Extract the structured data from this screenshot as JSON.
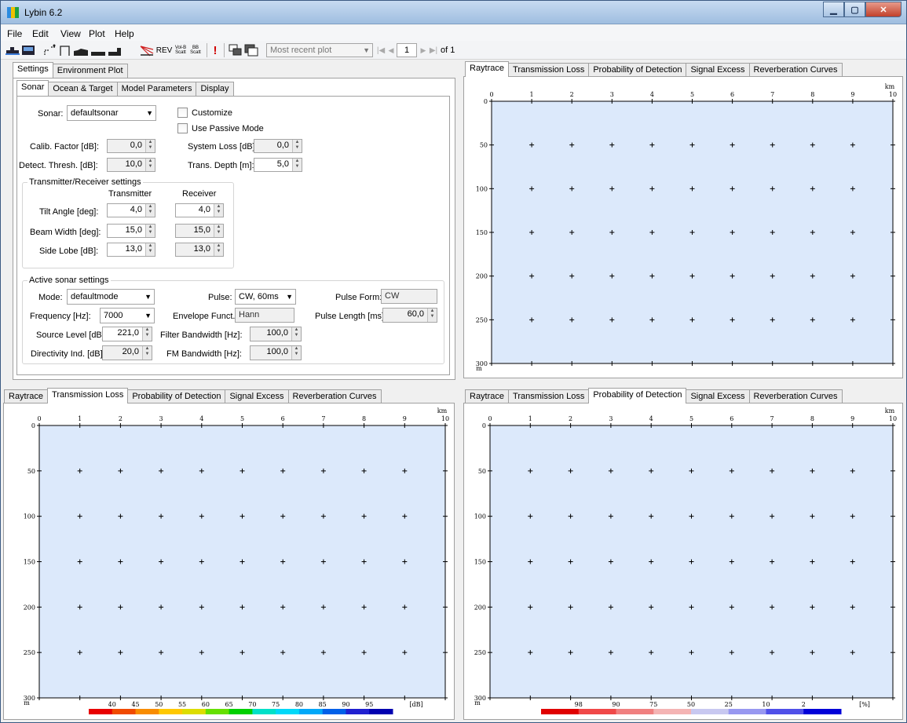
{
  "window": {
    "title": "Lybin 6.2",
    "accent": "#9fbee0"
  },
  "menu": [
    "File",
    "Edit",
    "View",
    "Plot",
    "Help"
  ],
  "toolbar": {
    "rev_label": "REV",
    "volb_label": "Vol-B",
    "scatt_label": "Scatt",
    "bb_label": "BB",
    "scatt2_label": "Scatt",
    "plot_select": "Most recent plot",
    "page": "1",
    "of_label": "of 1"
  },
  "settings_tabs": [
    "Settings",
    "Environment Plot"
  ],
  "sub_tabs": [
    "Sonar",
    "Ocean & Target",
    "Model Parameters",
    "Display"
  ],
  "sonar": {
    "sonar_label": "Sonar:",
    "sonar_value": "defaultsonar",
    "customize": "Customize",
    "passive": "Use Passive Mode",
    "calib_label": "Calib. Factor [dB]:",
    "calib_value": "0,0",
    "sysloss_label": "System Loss [dB]:",
    "sysloss_value": "0,0",
    "detect_label": "Detect. Thresh. [dB]:",
    "detect_value": "10,0",
    "depth_label": "Trans. Depth [m]:",
    "depth_value": "5,0"
  },
  "trx": {
    "title": "Transmitter/Receiver settings",
    "col_tx": "Transmitter",
    "col_rx": "Receiver",
    "rows": [
      {
        "label": "Tilt Angle [deg]:",
        "tx": "4,0",
        "rx": "4,0"
      },
      {
        "label": "Beam Width [deg]:",
        "tx": "15,0",
        "rx": "15,0"
      },
      {
        "label": "Side Lobe [dB]:",
        "tx": "13,0",
        "rx": "13,0"
      }
    ]
  },
  "active": {
    "title": "Active sonar settings",
    "mode_label": "Mode:",
    "mode_value": "defaultmode",
    "pulse_label": "Pulse:",
    "pulse_value": "CW, 60ms",
    "pulseform_label": "Pulse Form:",
    "pulseform_value": "CW",
    "freq_label": "Frequency [Hz]:",
    "freq_value": "7000",
    "env_label": "Envelope Funct.:",
    "env_value": "Hann",
    "plen_label": "Pulse Length [ms]:",
    "plen_value": "60,0",
    "sl_label": "Source Level [dB]:",
    "sl_value": "221,0",
    "fbw_label": "Filter Bandwidth [Hz]:",
    "fbw_value": "100,0",
    "di_label": "Directivity Ind. [dB]:",
    "di_value": "20,0",
    "fmbw_label": "FM Bandwidth [Hz]:",
    "fmbw_value": "100,0"
  },
  "plot_tabs": [
    "Raytrace",
    "Transmission Loss",
    "Probability of Detection",
    "Signal Excess",
    "Reverberation Curves"
  ],
  "chart_data": [
    {
      "type": "heatmap",
      "panel": "Raytrace",
      "x_ticks": [
        "0",
        "1",
        "2",
        "3",
        "4",
        "5",
        "6",
        "7",
        "8",
        "9",
        "10"
      ],
      "x_unit": "km",
      "y_ticks": [
        "0",
        "50",
        "100",
        "150",
        "200",
        "250",
        "300"
      ],
      "y_unit": "m",
      "xlim": [
        0,
        10
      ],
      "ylim": [
        0,
        300
      ],
      "grid": true,
      "background": "#dce9fb"
    },
    {
      "type": "heatmap",
      "panel": "Transmission Loss",
      "x_ticks": [
        "0",
        "1",
        "2",
        "3",
        "4",
        "5",
        "6",
        "7",
        "8",
        "9",
        "10"
      ],
      "x_unit": "km",
      "y_ticks": [
        "0",
        "50",
        "100",
        "150",
        "200",
        "250",
        "300"
      ],
      "y_unit": "m",
      "xlim": [
        0,
        10
      ],
      "ylim": [
        0,
        300
      ],
      "grid": true,
      "background": "#dce9fb",
      "colorbar": {
        "labels": [
          "40",
          "45",
          "50",
          "55",
          "60",
          "65",
          "70",
          "75",
          "80",
          "85",
          "90",
          "95"
        ],
        "unit": "[dB]",
        "colors": [
          "#e80000",
          "#f04a00",
          "#f88c00",
          "#ffc800",
          "#dddd00",
          "#66e000",
          "#00d000",
          "#00e0c8",
          "#00d8f8",
          "#00a8f8",
          "#0060e8",
          "#2020d0",
          "#0000b0"
        ]
      }
    },
    {
      "type": "heatmap",
      "panel": "Probability of Detection",
      "x_ticks": [
        "0",
        "1",
        "2",
        "3",
        "4",
        "5",
        "6",
        "7",
        "8",
        "9",
        "10"
      ],
      "x_unit": "km",
      "y_ticks": [
        "0",
        "50",
        "100",
        "150",
        "200",
        "250",
        "300"
      ],
      "y_unit": "m",
      "xlim": [
        0,
        10
      ],
      "ylim": [
        0,
        300
      ],
      "grid": true,
      "background": "#dce9fb",
      "colorbar": {
        "labels": [
          "98",
          "90",
          "75",
          "50",
          "25",
          "10",
          "2"
        ],
        "unit": "[%]",
        "colors": [
          "#e00000",
          "#f04848",
          "#f08080",
          "#f4b4b4",
          "#c8c8f0",
          "#9898f0",
          "#5050e8",
          "#0000d8"
        ]
      }
    }
  ]
}
